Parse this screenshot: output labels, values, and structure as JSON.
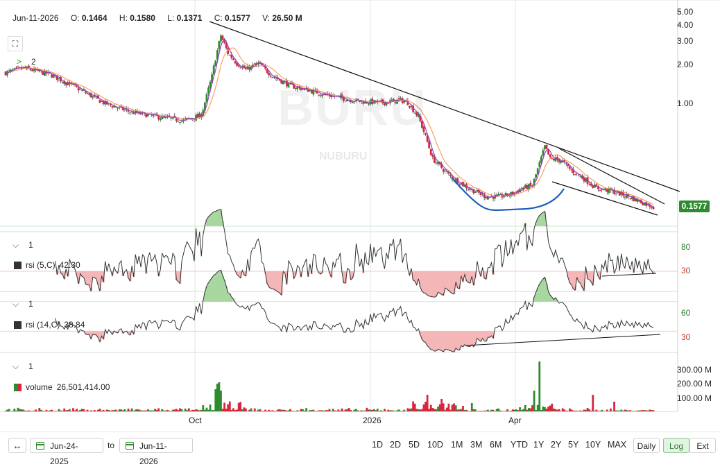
{
  "header": {
    "date": "Jun-11-2026",
    "open_label": "O:",
    "open": "0.1464",
    "high_label": "H:",
    "high": "0.1580",
    "low_label": "L:",
    "low": "0.1371",
    "close_label": "C:",
    "close": "0.1577",
    "volume_label": "V:",
    "volume": "26.50 M"
  },
  "watermark": {
    "symbol": "BURU",
    "name": "NUBURU"
  },
  "price_pane": {
    "indicator_count": "2",
    "last_price": "0.1577",
    "scale": "log"
  },
  "rsi5_pane": {
    "count": "1",
    "label": "rsi (5,C)",
    "value": "42.30"
  },
  "rsi14_pane": {
    "count": "1",
    "label": "rsi (14,C)",
    "value": "38.84"
  },
  "volume_pane": {
    "count": "1",
    "label": "volume",
    "value": "26,501,414.00"
  },
  "toolbar": {
    "start_date": "Jun-24-2025",
    "to_label": "to",
    "end_date": "Jun-11-2026",
    "ranges": [
      "1D",
      "2D",
      "5D",
      "10D",
      "1M",
      "3M",
      "6M",
      "YTD",
      "1Y",
      "2Y",
      "5Y",
      "10Y",
      "MAX"
    ],
    "interval": "Daily",
    "log_label": "Log",
    "ext_label": "Ext"
  },
  "colors": {
    "up": "#2e8b2e",
    "down": "#d7263d",
    "ma_fast": "#9b3fc4",
    "ma_slow": "#f4a261",
    "cup": "#1f5fbf"
  },
  "chart_data": {
    "type": "candlestick",
    "x_range": [
      "Jun-24-2025",
      "Jun-11-2026"
    ],
    "x_tick_labels": [
      "Oct",
      "2026",
      "Apr"
    ],
    "price": {
      "scale": "log",
      "y_tick_labels": [
        "5.00",
        "4.00",
        "3.00",
        "2.00",
        "1.00"
      ],
      "anchors": [
        {
          "date": "Jun-24-2025",
          "close": 1.7
        },
        {
          "date": "Jul-2025",
          "close": 1.65
        },
        {
          "date": "Aug-2025",
          "close": 1.05
        },
        {
          "date": "Sep-2025",
          "close": 0.72
        },
        {
          "date": "Oct-2025",
          "high": 4.3,
          "close": 2.0
        },
        {
          "date": "Nov-2025",
          "close": 1.5
        },
        {
          "date": "Dec-2025",
          "close": 1.0
        },
        {
          "date": "Jan-2026",
          "close": 1.05
        },
        {
          "date": "Feb-2026",
          "close": 0.33
        },
        {
          "date": "Mar-2026",
          "close": 0.22
        },
        {
          "date": "Apr-2026",
          "high": 0.47,
          "close": 0.36
        },
        {
          "date": "May-2026",
          "close": 0.22
        },
        {
          "date": "Jun-11-2026",
          "open": 0.1464,
          "high": 0.158,
          "low": 0.1371,
          "close": 0.1577
        }
      ]
    },
    "rsi5": {
      "levels": [
        80,
        30
      ],
      "last": 42.3
    },
    "rsi14": {
      "levels": [
        60,
        30
      ],
      "last": 38.84
    },
    "volume": {
      "y_tick_labels": [
        "300.00 M",
        "200.00 M",
        "100.00 M"
      ],
      "last": 26501414,
      "max_approx": 350000000
    }
  }
}
